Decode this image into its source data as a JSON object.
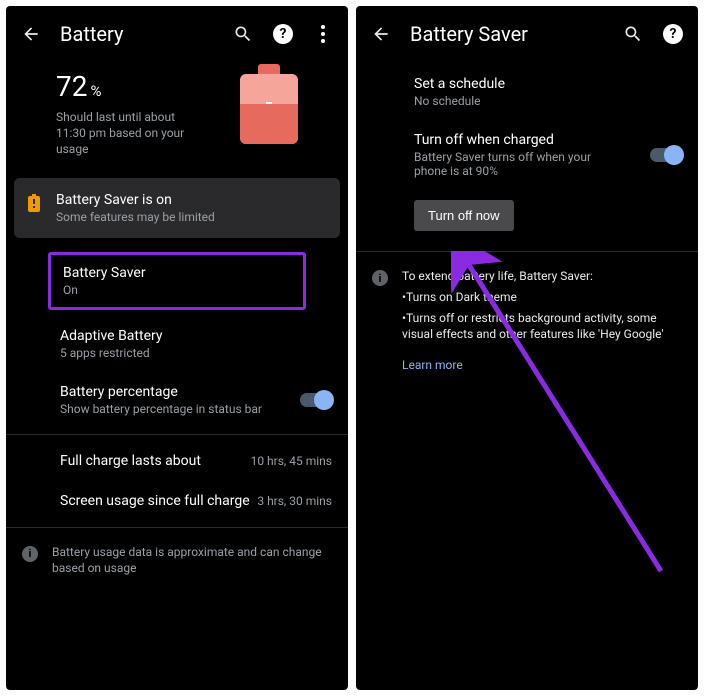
{
  "left": {
    "header": {
      "title": "Battery"
    },
    "hero": {
      "percent": "72",
      "percent_sign": "%",
      "subtitle": "Should last until about 11:30 pm based on your usage"
    },
    "banner": {
      "title": "Battery Saver is on",
      "subtitle": "Some features may be limited"
    },
    "battery_saver": {
      "title": "Battery Saver",
      "status": "On"
    },
    "adaptive": {
      "title": "Adaptive Battery",
      "subtitle": "5 apps restricted"
    },
    "percentage": {
      "title": "Battery percentage",
      "subtitle": "Show battery percentage in status bar"
    },
    "full_charge": {
      "title": "Full charge lasts about",
      "value": "10 hrs, 45 mins"
    },
    "screen_usage": {
      "title": "Screen usage since full charge",
      "value": "3 hrs, 30 mins"
    },
    "footer": "Battery usage data is approximate and can change based on usage"
  },
  "right": {
    "header": {
      "title": "Battery Saver"
    },
    "schedule": {
      "title": "Set a schedule",
      "subtitle": "No schedule"
    },
    "turn_off_charged": {
      "title": "Turn off when charged",
      "subtitle": "Battery Saver turns off when your phone is at 90%"
    },
    "turn_off_now": "Turn off now",
    "info": {
      "lead": "To extend battery life, Battery Saver:",
      "b1": "•Turns on Dark theme",
      "b2": "•Turns off or restricts background activity, some visual effects and other features like 'Hey Google'",
      "link": "Learn more"
    }
  }
}
